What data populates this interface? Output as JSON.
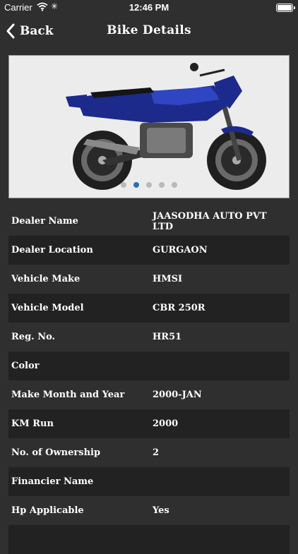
{
  "status_bar": {
    "carrier": "Carrier",
    "time": "12:46 PM"
  },
  "nav": {
    "back_label": "Back",
    "title": "Bike Details"
  },
  "carousel": {
    "page_count": 5,
    "active_index": 1
  },
  "details": [
    {
      "label": "Dealer Name",
      "value": "JAASODHA AUTO PVT LTD"
    },
    {
      "label": "Dealer Location",
      "value": "GURGAON"
    },
    {
      "label": "Vehicle Make",
      "value": "HMSI"
    },
    {
      "label": "Vehicle Model",
      "value": "CBR 250R"
    },
    {
      "label": "Reg. No.",
      "value": "HR51"
    },
    {
      "label": "Color",
      "value": ""
    },
    {
      "label": "Make Month and Year",
      "value": "2000-JAN"
    },
    {
      "label": "KM Run",
      "value": "2000"
    },
    {
      "label": "No. of Ownership",
      "value": "2"
    },
    {
      "label": "Financier Name",
      "value": ""
    },
    {
      "label": "Hp Applicable",
      "value": "Yes"
    }
  ],
  "colors": {
    "background": "#2f2f2f",
    "row_alt": "#222222",
    "dot_active": "#2d6fb2"
  }
}
